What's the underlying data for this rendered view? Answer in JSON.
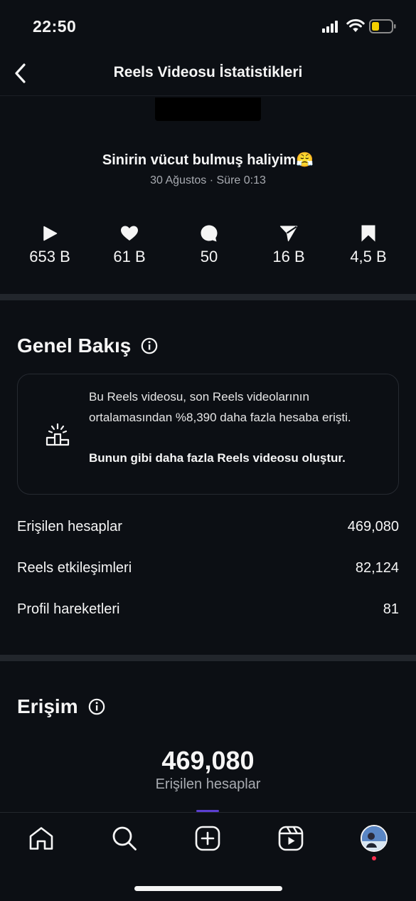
{
  "status_bar": {
    "time": "22:50"
  },
  "header": {
    "title": "Reels Videosu İstatistikleri"
  },
  "reel": {
    "caption": "Sinirin vücut bulmuş haliyim😤",
    "meta": "30 Ağustos · Süre 0:13"
  },
  "metrics": [
    {
      "icon": "play-icon",
      "value": "653 B"
    },
    {
      "icon": "heart-icon",
      "value": "61 B"
    },
    {
      "icon": "comment-icon",
      "value": "50"
    },
    {
      "icon": "share-icon",
      "value": "16 B"
    },
    {
      "icon": "bookmark-icon",
      "value": "4,5 B"
    }
  ],
  "overview": {
    "title": "Genel Bakış",
    "insight_text": "Bu Reels videosu, son Reels videolarının ortalamasından %8,390 daha fazla hesaba erişti.",
    "insight_link": "Bunun gibi daha fazla Reels videosu oluştur.",
    "stats": [
      {
        "label": "Erişilen hesaplar",
        "value": "469,080"
      },
      {
        "label": "Reels etkileşimleri",
        "value": "82,124"
      },
      {
        "label": "Profil hareketleri",
        "value": "81"
      }
    ]
  },
  "reach": {
    "title": "Erişim",
    "value": "469,080",
    "label": "Erişilen hesaplar"
  },
  "tab_bar": {
    "tabs": [
      "home-icon",
      "search-icon",
      "create-icon",
      "reels-icon",
      "profile-avatar"
    ]
  },
  "colors": {
    "background": "#0c0f14",
    "divider": "#22262c",
    "secondary_text": "#a8abb1",
    "notification": "#ff2d4d",
    "battery_low": "#f5d000"
  }
}
